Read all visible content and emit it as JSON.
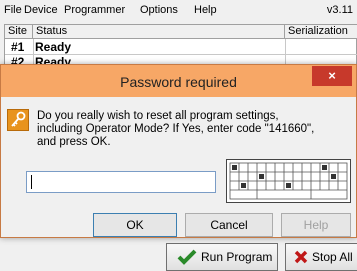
{
  "menubar": {
    "items": [
      "File",
      "Device",
      "Programmer",
      "Options",
      "Help"
    ],
    "version": "v3.11"
  },
  "grid": {
    "headers": [
      "Site",
      "Status",
      "Serialization"
    ],
    "rows": [
      {
        "site": "#1",
        "status": "Ready"
      },
      {
        "site": "#2",
        "status": "Ready"
      }
    ]
  },
  "buttons": {
    "run": "Run Program",
    "stop": "Stop All"
  },
  "dialog": {
    "title": "Password required",
    "close": "×",
    "message_lines": [
      "Do you really wish to reset all program settings,",
      "including Operator Mode? If Yes, enter code \"141660\",",
      "and press OK."
    ],
    "input_value": "",
    "ok": "OK",
    "cancel": "Cancel",
    "help": "Help"
  },
  "colors": {
    "title_bg": "#f7a766",
    "close_bg": "#c7392b",
    "icon": "#e8931d",
    "run_check": "#2a8a2a",
    "stop_x": "#c01818"
  }
}
